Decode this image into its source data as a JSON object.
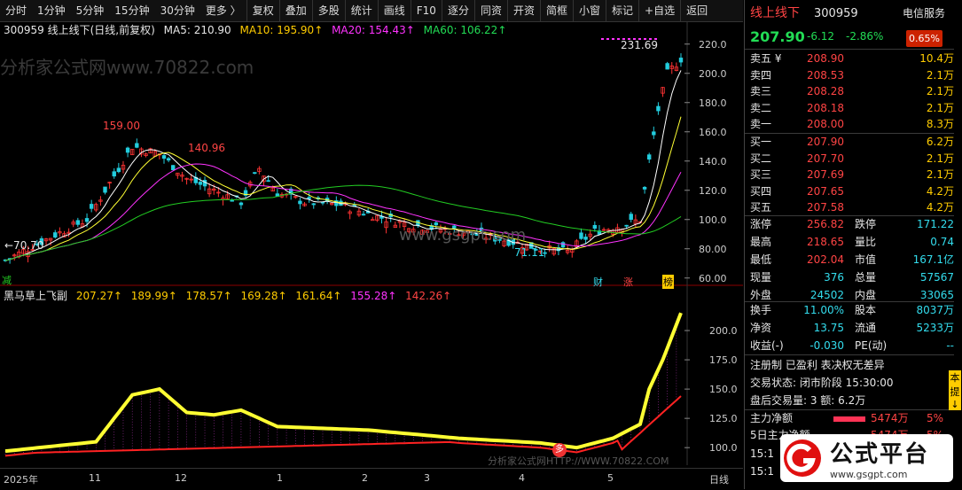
{
  "toolbar": {
    "items": [
      "分时",
      "1分钟",
      "5分钟",
      "15分钟",
      "30分钟",
      "更多 〉",
      "复权",
      "叠加",
      "多股",
      "统计",
      "画线",
      "F10",
      "逐分",
      "同资",
      "开资",
      "简框",
      "小窗",
      "标记",
      "+自选",
      "返回"
    ]
  },
  "chart": {
    "legend_main": {
      "symbol": "300959 线上线下(日线,前复权)",
      "ma5": "MA5: 210.90",
      "ma10": "MA10: 195.90↑",
      "ma20": "MA20: 154.43↑",
      "ma60": "MA60: 106.22↑"
    },
    "legend_sub": {
      "name": "黑马草上飞副",
      "v1": "207.27↑",
      "v2": "189.99↑",
      "v3": "178.57↑",
      "v4": "169.28↑",
      "v5": "161.64↑",
      "v6": "155.28↑",
      "v7": "142.26↑"
    },
    "annotations": {
      "high1": "159.00",
      "high2": "140.96",
      "low1": "←70.70",
      "low2": "71.11",
      "peak": "231.69"
    },
    "price_axis": [
      "220.0",
      "200.0",
      "180.0",
      "160.0",
      "140.0",
      "120.0",
      "100.0",
      "80.00",
      "60.00"
    ],
    "sub_axis": [
      "200.0",
      "175.0",
      "150.0",
      "125.0",
      "100.0"
    ],
    "x_labels": [
      "2025年",
      "11",
      "12",
      "1",
      "2",
      "3",
      "4",
      "5"
    ],
    "period_label": "日线",
    "markers": {
      "jian": "减",
      "cai": "财",
      "zhang": "涨",
      "bang": "榜",
      "duo": "多"
    },
    "watermarks": [
      "分析家公式网www.70822.com",
      "www.gsgpt.com",
      "分析家公式网HTTP://WWW.70822.COM"
    ],
    "colors": {
      "up": "#ff3333",
      "down": "#22ccdd",
      "ma5": "#ffffff",
      "ma10": "#ffff33",
      "ma20": "#ff33ff",
      "ma60": "#22cc22",
      "sub_yellow": "#ffff33",
      "sub_white": "#cccccc",
      "sub_red": "#ff2222"
    }
  },
  "chart_data": {
    "type": "line",
    "x": [
      "2025-10",
      "2025-11",
      "2025-12",
      "2026-01",
      "2026-02",
      "2026-03",
      "2026-04",
      "2026-05"
    ],
    "series": [
      {
        "name": "MA5",
        "values": [
          72,
          120,
          130,
          112,
          98,
          92,
          84,
          210.9
        ]
      },
      {
        "name": "MA10",
        "values": [
          70,
          110,
          128,
          113,
          100,
          93,
          83,
          195.9
        ]
      },
      {
        "name": "MA20",
        "values": [
          68,
          100,
          125,
          114,
          102,
          95,
          82,
          154.43
        ]
      },
      {
        "name": "MA60",
        "values": [
          60,
          75,
          95,
          108,
          108,
          101,
          88,
          106.22
        ]
      }
    ],
    "ylim": [
      55,
      235
    ]
  },
  "panel": {
    "title": "线上线下",
    "code": "300959",
    "service": "电信服务",
    "price": "207.90",
    "change": "-6.12",
    "change_pct": "-2.86%",
    "turnover_badge": "0.65%",
    "asks": [
      {
        "label": "卖五 ¥",
        "price": "208.90",
        "vol": "10.4万"
      },
      {
        "label": "卖四",
        "price": "208.53",
        "vol": "2.1万"
      },
      {
        "label": "卖三",
        "price": "208.28",
        "vol": "2.1万"
      },
      {
        "label": "卖二",
        "price": "208.18",
        "vol": "2.1万"
      },
      {
        "label": "卖一",
        "price": "208.00",
        "vol": "8.3万"
      }
    ],
    "bids": [
      {
        "label": "买一",
        "price": "207.90",
        "vol": "6.2万"
      },
      {
        "label": "买二",
        "price": "207.70",
        "vol": "2.1万"
      },
      {
        "label": "买三",
        "price": "207.69",
        "vol": "2.1万"
      },
      {
        "label": "买四",
        "price": "207.65",
        "vol": "4.2万"
      },
      {
        "label": "买五",
        "price": "207.58",
        "vol": "4.2万"
      }
    ],
    "stats": [
      {
        "l1": "涨停",
        "v1": "256.82",
        "l2": "跌停",
        "v2": "171.22"
      },
      {
        "l1": "最高",
        "v1": "218.65",
        "l2": "量比",
        "v2": "0.74"
      },
      {
        "l1": "最低",
        "v1": "202.04",
        "l2": "市值",
        "v2": "167.1亿"
      },
      {
        "l1": "现量",
        "v1": "376",
        "l2": "总量",
        "v2": "57567"
      },
      {
        "l1": "外盘",
        "v1": "24502",
        "l2": "内盘",
        "v2": "33065"
      }
    ],
    "stats2": [
      {
        "l1": "换手",
        "v1": "11.00%",
        "l2": "股本",
        "v2": "8037万"
      },
      {
        "l1": "净资",
        "v1": "13.75",
        "l2": "流通",
        "v2": "5233万"
      },
      {
        "l1": "收益(-)",
        "v1": "-0.030",
        "l2": "PE(动)",
        "v2": "--"
      }
    ],
    "info_line": "注册制 已盈利 表决权无差异",
    "trade_status": "交易状态: 闭市阶段 15:30:00",
    "after_hours": "盘后交易量: 3  额: 6.2万",
    "main_flow_label": "主力净额",
    "main_flow_value": "5474万",
    "main_flow_pct": "5%",
    "main_flow5_label": "5日主力净额",
    "main_flow5_value": "5474万",
    "main_flow5_pct": "5%",
    "time1": "15:1",
    "time2": "15:1",
    "side_tags": [
      "本",
      "提",
      "↓"
    ]
  },
  "logo": {
    "text": "公式平台",
    "url": "www.gsgpt.com"
  }
}
